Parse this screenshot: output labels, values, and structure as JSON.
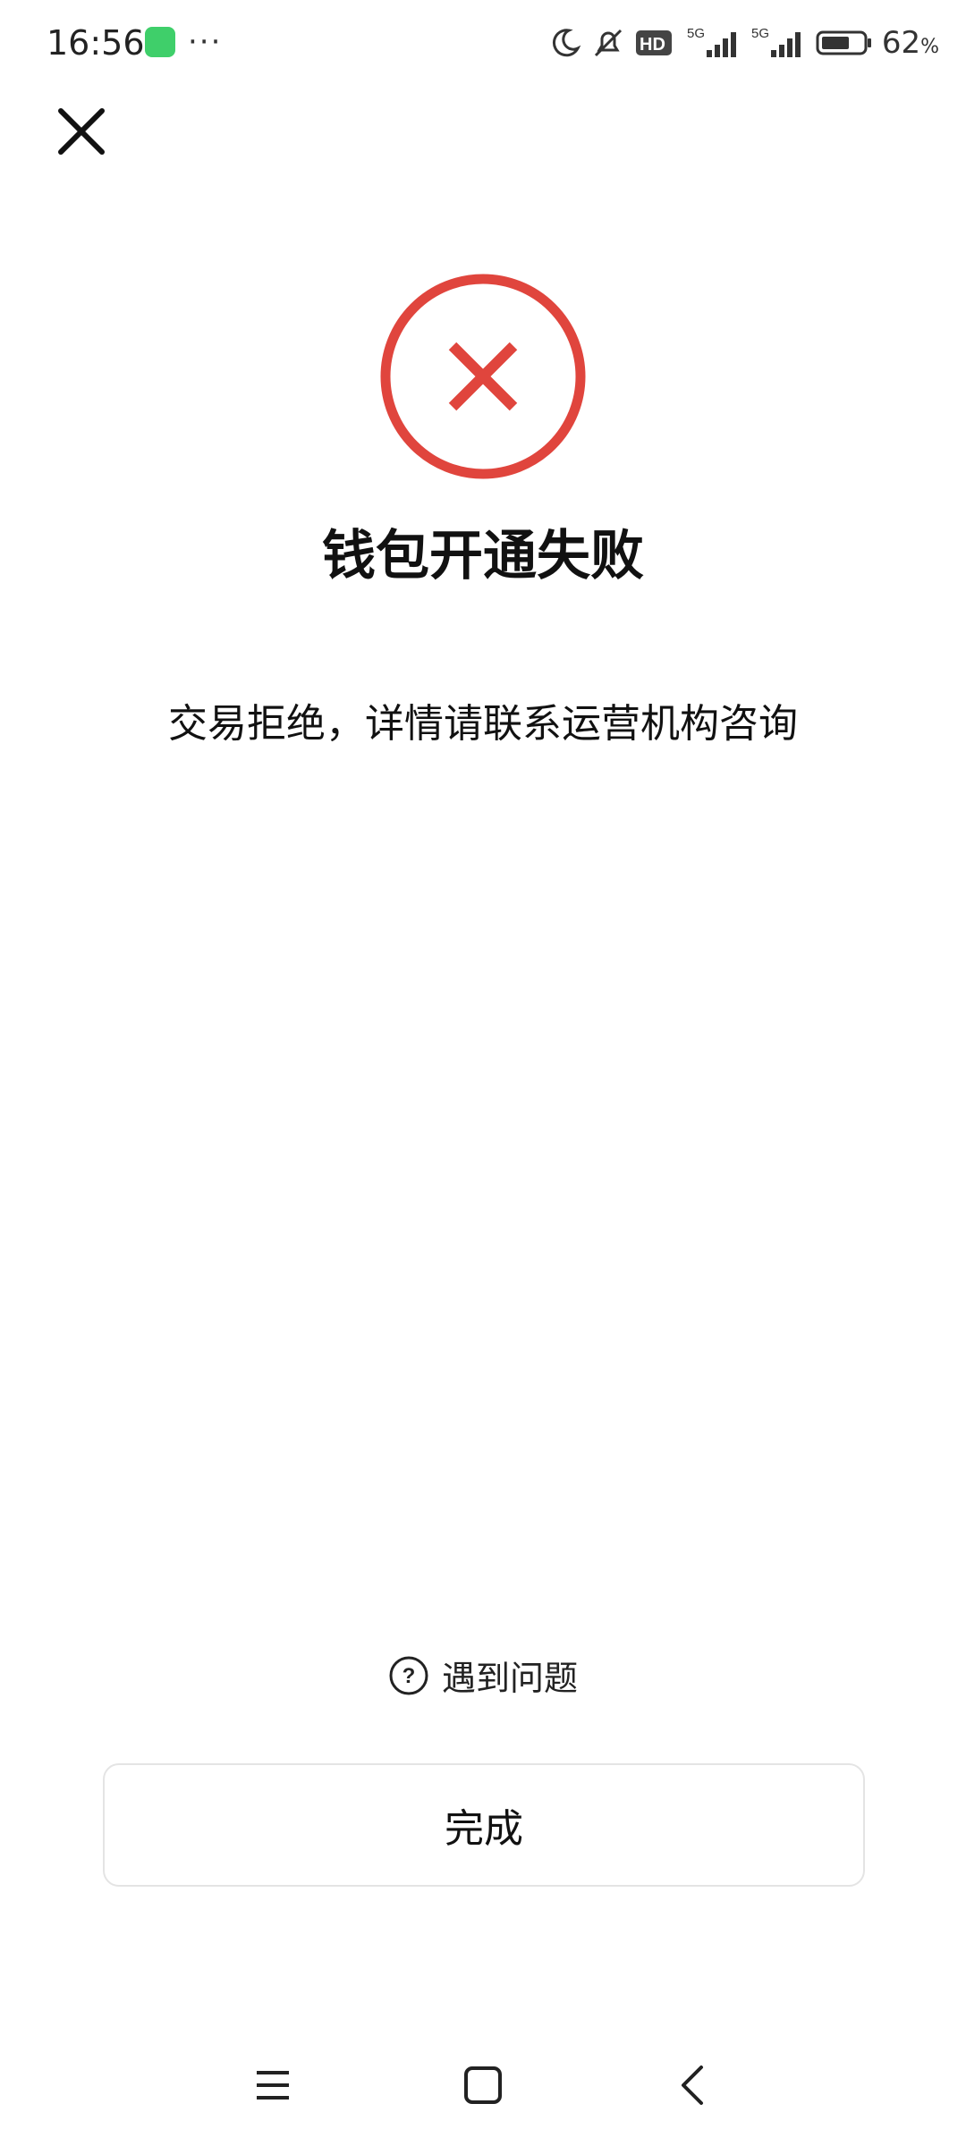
{
  "status_bar": {
    "time": "16:56",
    "more": "···",
    "battery_percent": "62",
    "battery_unit": "%",
    "network_1": "5G",
    "network_2": "5G",
    "hd_label": "HD"
  },
  "page": {
    "title": "钱包开通失败",
    "message": "交易拒绝，详情请联系运营机构咨询",
    "help_label": "遇到问题",
    "done_label": "完成"
  },
  "icons": {
    "close": "close-icon",
    "fail": "error-circle-icon",
    "help": "question-circle-icon",
    "nav_menu": "menu-icon",
    "nav_home": "home-square-icon",
    "nav_back": "back-chevron-icon"
  },
  "colors": {
    "error_red": "#e0453d",
    "text": "#111111",
    "button_border": "#e4e4e4"
  }
}
